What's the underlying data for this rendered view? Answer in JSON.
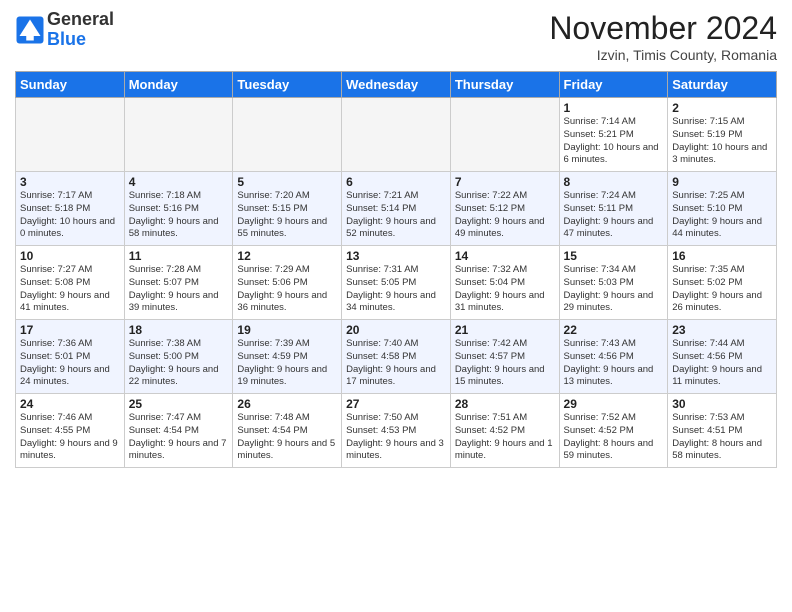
{
  "logo": {
    "general": "General",
    "blue": "Blue"
  },
  "header": {
    "month": "November 2024",
    "location": "Izvin, Timis County, Romania"
  },
  "weekdays": [
    "Sunday",
    "Monday",
    "Tuesday",
    "Wednesday",
    "Thursday",
    "Friday",
    "Saturday"
  ],
  "weeks": [
    [
      {
        "day": "",
        "info": ""
      },
      {
        "day": "",
        "info": ""
      },
      {
        "day": "",
        "info": ""
      },
      {
        "day": "",
        "info": ""
      },
      {
        "day": "",
        "info": ""
      },
      {
        "day": "1",
        "info": "Sunrise: 7:14 AM\nSunset: 5:21 PM\nDaylight: 10 hours and 6 minutes."
      },
      {
        "day": "2",
        "info": "Sunrise: 7:15 AM\nSunset: 5:19 PM\nDaylight: 10 hours and 3 minutes."
      }
    ],
    [
      {
        "day": "3",
        "info": "Sunrise: 7:17 AM\nSunset: 5:18 PM\nDaylight: 10 hours and 0 minutes."
      },
      {
        "day": "4",
        "info": "Sunrise: 7:18 AM\nSunset: 5:16 PM\nDaylight: 9 hours and 58 minutes."
      },
      {
        "day": "5",
        "info": "Sunrise: 7:20 AM\nSunset: 5:15 PM\nDaylight: 9 hours and 55 minutes."
      },
      {
        "day": "6",
        "info": "Sunrise: 7:21 AM\nSunset: 5:14 PM\nDaylight: 9 hours and 52 minutes."
      },
      {
        "day": "7",
        "info": "Sunrise: 7:22 AM\nSunset: 5:12 PM\nDaylight: 9 hours and 49 minutes."
      },
      {
        "day": "8",
        "info": "Sunrise: 7:24 AM\nSunset: 5:11 PM\nDaylight: 9 hours and 47 minutes."
      },
      {
        "day": "9",
        "info": "Sunrise: 7:25 AM\nSunset: 5:10 PM\nDaylight: 9 hours and 44 minutes."
      }
    ],
    [
      {
        "day": "10",
        "info": "Sunrise: 7:27 AM\nSunset: 5:08 PM\nDaylight: 9 hours and 41 minutes."
      },
      {
        "day": "11",
        "info": "Sunrise: 7:28 AM\nSunset: 5:07 PM\nDaylight: 9 hours and 39 minutes."
      },
      {
        "day": "12",
        "info": "Sunrise: 7:29 AM\nSunset: 5:06 PM\nDaylight: 9 hours and 36 minutes."
      },
      {
        "day": "13",
        "info": "Sunrise: 7:31 AM\nSunset: 5:05 PM\nDaylight: 9 hours and 34 minutes."
      },
      {
        "day": "14",
        "info": "Sunrise: 7:32 AM\nSunset: 5:04 PM\nDaylight: 9 hours and 31 minutes."
      },
      {
        "day": "15",
        "info": "Sunrise: 7:34 AM\nSunset: 5:03 PM\nDaylight: 9 hours and 29 minutes."
      },
      {
        "day": "16",
        "info": "Sunrise: 7:35 AM\nSunset: 5:02 PM\nDaylight: 9 hours and 26 minutes."
      }
    ],
    [
      {
        "day": "17",
        "info": "Sunrise: 7:36 AM\nSunset: 5:01 PM\nDaylight: 9 hours and 24 minutes."
      },
      {
        "day": "18",
        "info": "Sunrise: 7:38 AM\nSunset: 5:00 PM\nDaylight: 9 hours and 22 minutes."
      },
      {
        "day": "19",
        "info": "Sunrise: 7:39 AM\nSunset: 4:59 PM\nDaylight: 9 hours and 19 minutes."
      },
      {
        "day": "20",
        "info": "Sunrise: 7:40 AM\nSunset: 4:58 PM\nDaylight: 9 hours and 17 minutes."
      },
      {
        "day": "21",
        "info": "Sunrise: 7:42 AM\nSunset: 4:57 PM\nDaylight: 9 hours and 15 minutes."
      },
      {
        "day": "22",
        "info": "Sunrise: 7:43 AM\nSunset: 4:56 PM\nDaylight: 9 hours and 13 minutes."
      },
      {
        "day": "23",
        "info": "Sunrise: 7:44 AM\nSunset: 4:56 PM\nDaylight: 9 hours and 11 minutes."
      }
    ],
    [
      {
        "day": "24",
        "info": "Sunrise: 7:46 AM\nSunset: 4:55 PM\nDaylight: 9 hours and 9 minutes."
      },
      {
        "day": "25",
        "info": "Sunrise: 7:47 AM\nSunset: 4:54 PM\nDaylight: 9 hours and 7 minutes."
      },
      {
        "day": "26",
        "info": "Sunrise: 7:48 AM\nSunset: 4:54 PM\nDaylight: 9 hours and 5 minutes."
      },
      {
        "day": "27",
        "info": "Sunrise: 7:50 AM\nSunset: 4:53 PM\nDaylight: 9 hours and 3 minutes."
      },
      {
        "day": "28",
        "info": "Sunrise: 7:51 AM\nSunset: 4:52 PM\nDaylight: 9 hours and 1 minute."
      },
      {
        "day": "29",
        "info": "Sunrise: 7:52 AM\nSunset: 4:52 PM\nDaylight: 8 hours and 59 minutes."
      },
      {
        "day": "30",
        "info": "Sunrise: 7:53 AM\nSunset: 4:51 PM\nDaylight: 8 hours and 58 minutes."
      }
    ]
  ]
}
